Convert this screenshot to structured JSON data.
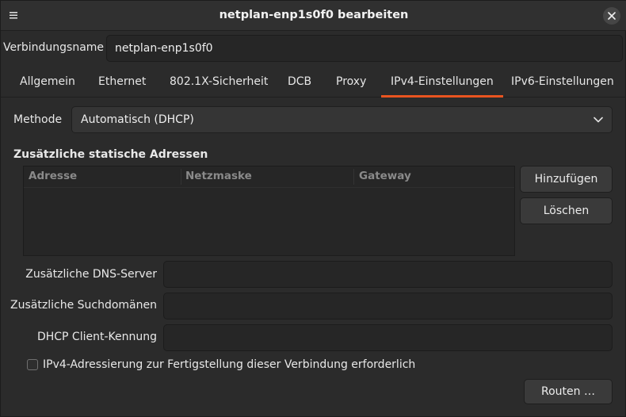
{
  "window": {
    "title": "netplan-enp1s0f0 bearbeiten",
    "menu_icon": "hamburger-menu-icon",
    "close_icon": "close-icon"
  },
  "connection": {
    "label": "Verbindungsname",
    "value": "netplan-enp1s0f0"
  },
  "tabs": [
    {
      "label": "Allgemein"
    },
    {
      "label": "Ethernet"
    },
    {
      "label": "802.1X-Sicherheit"
    },
    {
      "label": "DCB"
    },
    {
      "label": "Proxy"
    },
    {
      "label": "IPv4-Einstellungen",
      "active": true
    },
    {
      "label": "IPv6-Einstellungen"
    }
  ],
  "ipv4": {
    "method_label": "Methode",
    "method_value": "Automatisch (DHCP)",
    "static_title": "Zusätzliche statische Adressen",
    "columns": [
      "Adresse",
      "Netzmaske",
      "Gateway"
    ],
    "rows": [],
    "add_label": "Hinzufügen",
    "delete_label": "Löschen",
    "dns_label": "Zusätzliche DNS-Server",
    "dns_value": "",
    "search_label": "Zusätzliche Suchdomänen",
    "search_value": "",
    "client_id_label": "DHCP Client-Kennung",
    "client_id_value": "",
    "require_label": "IPv4-Adressierung zur Fertigstellung dieser Verbindung erforderlich",
    "require_checked": false,
    "routes_label": "Routen …"
  },
  "colors": {
    "accent": "#e95420",
    "background": "#2b2b2b"
  }
}
